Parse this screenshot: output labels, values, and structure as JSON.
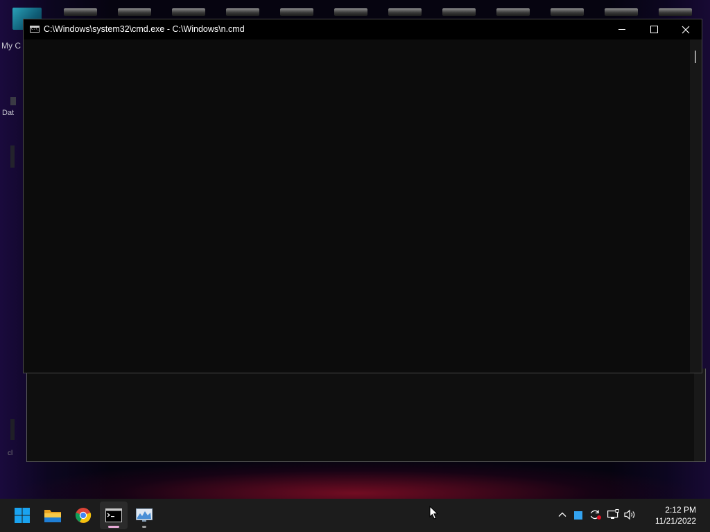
{
  "desktop": {
    "partial_labels": [
      "My C",
      "Dat",
      "cl"
    ]
  },
  "cmd_window": {
    "title": "C:\\Windows\\system32\\cmd.exe - C:\\Windows\\n.cmd",
    "icon": "console-icon",
    "icon_text": "C:\\_",
    "controls": [
      "minimize-icon",
      "maximize-icon",
      "close-icon"
    ]
  },
  "taskbar": {
    "apps": [
      {
        "name": "Start",
        "icon": "windows-logo-icon"
      },
      {
        "name": "File Explorer",
        "icon": "folder-icon"
      },
      {
        "name": "Google Chrome",
        "icon": "chrome-icon"
      },
      {
        "name": "Command Prompt",
        "icon": "cmd-icon",
        "active": true
      },
      {
        "name": "Resource Monitor",
        "icon": "monitor-chart-icon"
      }
    ],
    "tray_icons": [
      "chevron-up-icon",
      "blue-square-icon",
      "sync-icon",
      "network-icon",
      "volume-icon"
    ],
    "clock": {
      "time": "2:12 PM",
      "date": "11/21/2022"
    }
  },
  "colors": {
    "accent": "#0078d4",
    "console_bg": "#0c0c0c",
    "titlebar_bg": "#000000",
    "taskbar_bg": "#1c1c1c"
  }
}
